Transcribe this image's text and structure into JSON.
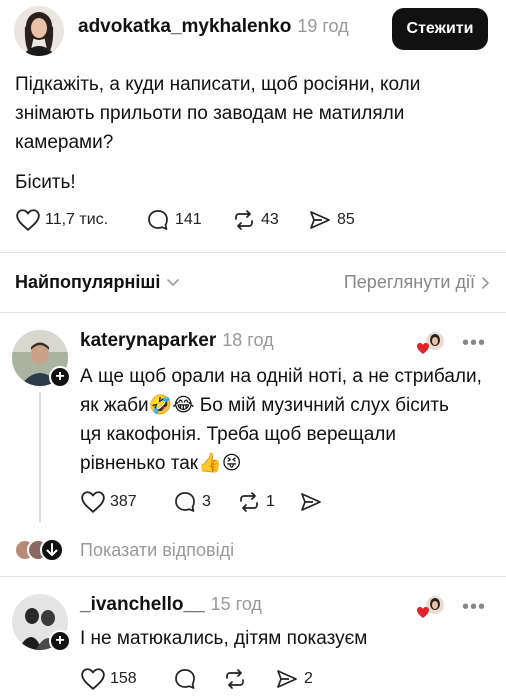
{
  "post": {
    "author": "advokatka_mykhalenko",
    "time": "19 год",
    "follow_label": "Стежити",
    "text_line1": "Підкажіть, а куди написати,  щоб росіяни,  коли",
    "text_line2": "знімають прильоти по заводам не матиляли",
    "text_line3": "камерами?",
    "text_line4": "Бісить!",
    "likes": "11,7 тис.",
    "comments": "141",
    "reposts": "43",
    "shares": "85"
  },
  "sort": {
    "label": "Найпопулярніші",
    "activity_label": "Переглянути дії"
  },
  "replies": [
    {
      "author": "katerynaparker",
      "time": "18 год",
      "line1": "А ще щоб орали на одній ноті, а не стрибали,",
      "line2": "як жаби🤣😂 Бо мій музичний слух бісить",
      "line3": "ця какофонія. Треба щоб верещали",
      "line4": "рівненько так👍😝",
      "likes": "387",
      "comments": "3",
      "reposts": "1",
      "show_replies": "Показати відповіді"
    },
    {
      "author": "_ivanchello__",
      "time": "15 год",
      "line1": "І не матюкались, дітям показуєм",
      "likes": "158",
      "shares": "2"
    }
  ],
  "more_label": "•••"
}
